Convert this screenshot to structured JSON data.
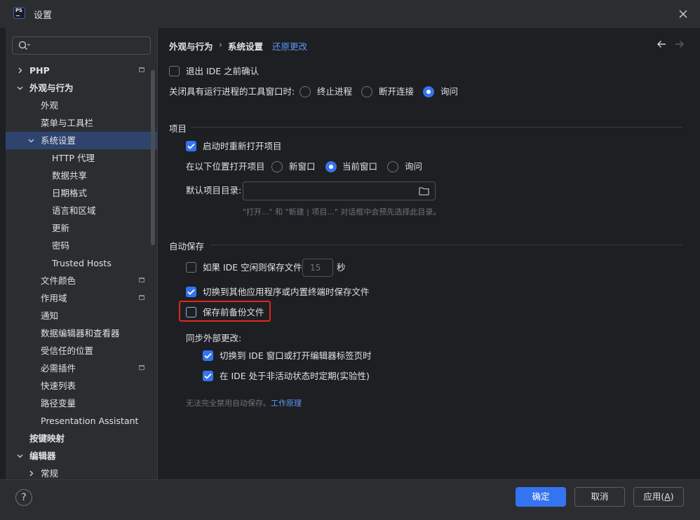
{
  "window": {
    "title": "设置",
    "app_icon_text": "PS"
  },
  "search": {
    "placeholder": ""
  },
  "sidebar": {
    "items": [
      {
        "label": "PHP",
        "bold": true,
        "chevron": "right",
        "has_project_icon": true
      },
      {
        "label": "外观与行为",
        "bold": true,
        "chevron": "down"
      },
      {
        "label": "外观"
      },
      {
        "label": "菜单与工具栏"
      },
      {
        "label": "系统设置",
        "chevron": "down",
        "selected": true
      },
      {
        "label": "HTTP 代理"
      },
      {
        "label": "数据共享"
      },
      {
        "label": "日期格式"
      },
      {
        "label": "语言和区域"
      },
      {
        "label": "更新"
      },
      {
        "label": "密码"
      },
      {
        "label": "Trusted Hosts"
      },
      {
        "label": "文件颜色",
        "has_project_icon": true
      },
      {
        "label": "作用域",
        "has_project_icon": true
      },
      {
        "label": "通知"
      },
      {
        "label": "数据编辑器和查看器"
      },
      {
        "label": "受信任的位置"
      },
      {
        "label": "必需插件",
        "has_project_icon": true
      },
      {
        "label": "快速列表"
      },
      {
        "label": "路径变量"
      },
      {
        "label": "Presentation Assistant"
      },
      {
        "label": "按键映射",
        "bold": true
      },
      {
        "label": "编辑器",
        "bold": true,
        "chevron": "down"
      },
      {
        "label": "常规",
        "chevron": "right"
      }
    ]
  },
  "breadcrumb": {
    "part1": "外观与行为",
    "separator": "›",
    "part2": "系统设置",
    "reset_link": "还原更改"
  },
  "general": {
    "confirm_exit_label": "退出 IDE 之前确认",
    "confirm_exit_checked": false,
    "close_running_label": "关闭具有运行进程的工具窗口时:",
    "close_running_options": [
      "终止进程",
      "断开连接",
      "询问"
    ],
    "close_running_selected": "询问"
  },
  "project": {
    "section_title": "项目",
    "reopen_label": "启动时重新打开项目",
    "reopen_checked": true,
    "open_in_label": "在以下位置打开项目",
    "open_in_options": [
      "新窗口",
      "当前窗口",
      "询问"
    ],
    "open_in_selected": "当前窗口",
    "default_dir_label": "默认项目目录:",
    "default_dir_value": "",
    "default_dir_hint": "\"打开...\" 和 \"新建 | 项目...\" 对话框中会预先选择此目录。"
  },
  "autosave": {
    "section_title": "自动保存",
    "idle_label": "如果 IDE 空闲则保存文件",
    "idle_checked": false,
    "idle_seconds": "15",
    "idle_unit": "秒",
    "frame_deactivation_label": "切换到其他应用程序或内置终端时保存文件",
    "frame_deactivation_checked": true,
    "backup_label": "保存前备份文件",
    "backup_checked": false,
    "sync_label": "同步外部更改:",
    "sync_switch_label": "切换到 IDE 窗口或打开编辑器标签页时",
    "sync_switch_checked": true,
    "sync_periodic_label": "在 IDE 处于非活动状态时定期(实验性)",
    "sync_periodic_checked": true,
    "note_text": "无法完全禁用自动保存。",
    "note_link": "工作原理"
  },
  "footer": {
    "help_label": "?",
    "ok_label": "确定",
    "cancel_label": "取消",
    "apply_label": "应用",
    "apply_mnemonic": "A"
  },
  "colors": {
    "accent": "#3574f0",
    "link": "#5e97f6",
    "highlight_box": "#e0271f",
    "selection": "#2e436e"
  }
}
